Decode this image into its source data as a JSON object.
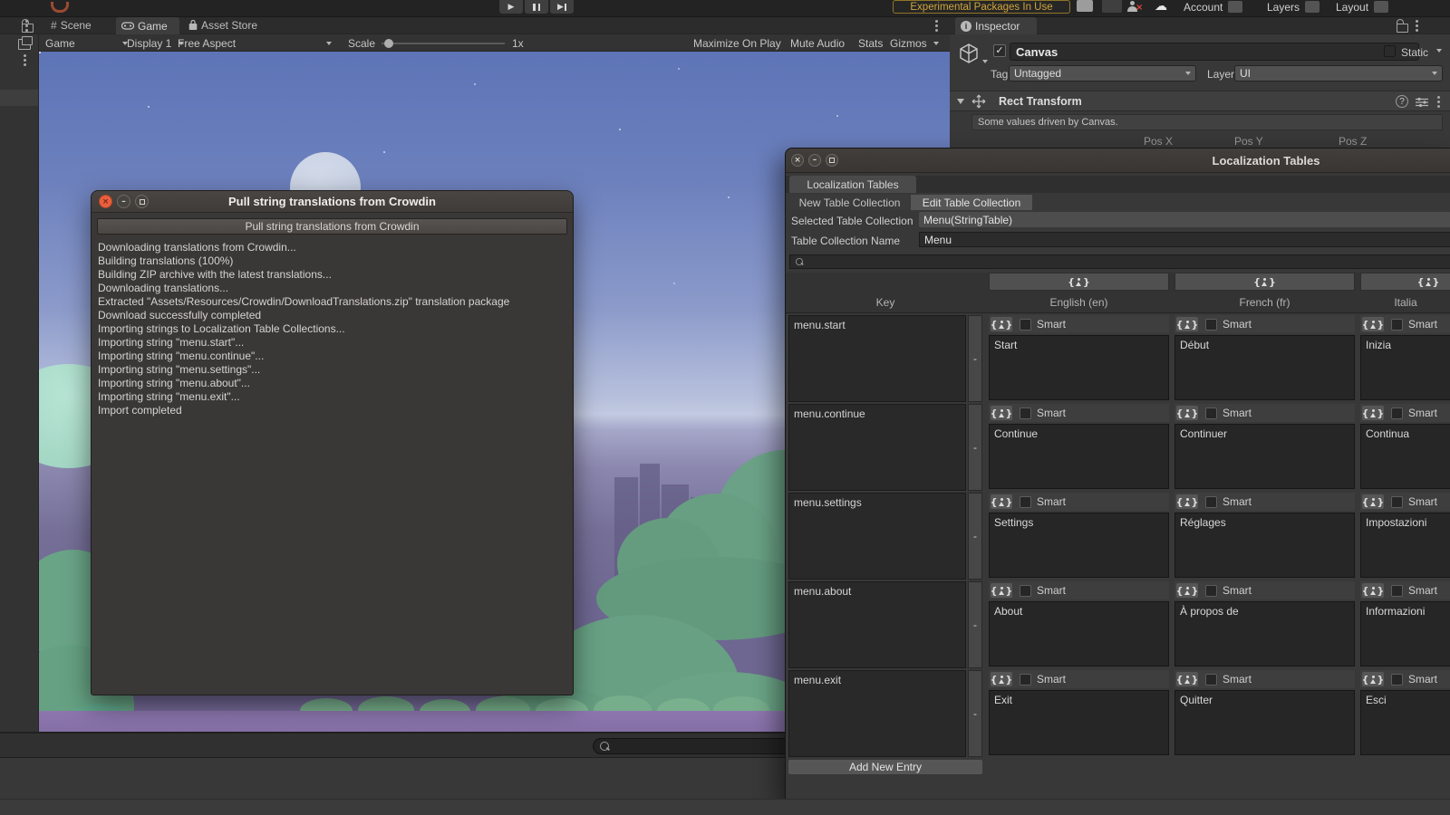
{
  "topbar": {
    "experimental": "Experimental Packages In Use",
    "account": "Account",
    "layers": "Layers",
    "layout": "Layout"
  },
  "tabs": {
    "scene": "Scene",
    "game": "Game",
    "asset_store": "Asset Store",
    "inspector": "Inspector"
  },
  "game_toolbar": {
    "game": "Game",
    "display": "Display 1",
    "aspect": "Free Aspect",
    "scale_label": "Scale",
    "scale_value": "1x",
    "maximize": "Maximize On Play",
    "mute": "Mute Audio",
    "stats": "Stats",
    "gizmos": "Gizmos"
  },
  "inspector": {
    "name": "Canvas",
    "static_label": "Static",
    "tag_label": "Tag",
    "tag_value": "Untagged",
    "layer_label": "Layer",
    "layer_value": "UI",
    "component": "Rect Transform",
    "help": "Some values driven by Canvas.",
    "pos_x": "Pos X",
    "pos_y": "Pos Y",
    "pos_z": "Pos Z"
  },
  "dialog": {
    "title": "Pull string translations from Crowdin",
    "button": "Pull string translations from Crowdin",
    "log": [
      "Downloading translations from Crowdin...",
      "Building translations (100%)",
      "Building ZIP archive with the latest translations...",
      "Downloading translations...",
      "Extracted \"Assets/Resources/Crowdin/DownloadTranslations.zip\" translation package",
      "Download successfully completed",
      "Importing strings to Localization Table Collections...",
      "Importing string \"menu.start\"...",
      "Importing string \"menu.continue\"...",
      "Importing string \"menu.settings\"...",
      "Importing string \"menu.about\"...",
      "Importing string \"menu.exit\"...",
      "Import completed"
    ]
  },
  "loc": {
    "window_title": "Localization Tables",
    "tab": "Localization Tables",
    "new_btn": "New Table Collection",
    "edit_btn": "Edit Table Collection",
    "selected_label": "Selected Table Collection",
    "selected_value": "Menu(StringTable)",
    "name_label": "Table Collection Name",
    "name_value": "Menu",
    "columns": {
      "key": "Key",
      "en": "English (en)",
      "fr": "French (fr)",
      "it": "Italia"
    },
    "smart": "Smart",
    "remove": "-",
    "add_entry": "Add New Entry",
    "rows": [
      {
        "key": "menu.start",
        "en": "Start",
        "fr": "Début",
        "it": "Inizia"
      },
      {
        "key": "menu.continue",
        "en": "Continue",
        "fr": "Continuer",
        "it": "Continua"
      },
      {
        "key": "menu.settings",
        "en": "Settings",
        "fr": "Réglages",
        "it": "Impostazioni"
      },
      {
        "key": "menu.about",
        "en": "About",
        "fr": "À propos de",
        "it": "Informazioni"
      },
      {
        "key": "menu.exit",
        "en": "Exit",
        "fr": "Quitter",
        "it": "Esci"
      }
    ]
  },
  "colors": {
    "close_button": "#e9603f",
    "experimental_text": "#cfa43b",
    "sky_top": "#5f76b8",
    "ground_purple": "#6f6890",
    "tree_green": "#68a083"
  }
}
